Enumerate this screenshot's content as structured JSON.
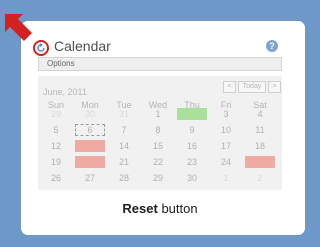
{
  "header": {
    "title": "Calendar"
  },
  "options_bar": {
    "label": "Options"
  },
  "calendar": {
    "month_label": "June, 2011",
    "nav": {
      "prev": "<",
      "today": "Today",
      "next": ">"
    },
    "weekdays": [
      "Sun",
      "Mon",
      "Tue",
      "Wed",
      "Thu",
      "Fri",
      "Sat"
    ],
    "weeks": [
      [
        "29",
        "30",
        "31",
        "1",
        "2",
        "3",
        "4"
      ],
      [
        "5",
        "6",
        "7",
        "8",
        "9",
        "10",
        "11"
      ],
      [
        "12",
        "13",
        "14",
        "15",
        "16",
        "17",
        "18"
      ],
      [
        "19",
        "20",
        "21",
        "22",
        "23",
        "24",
        "25"
      ],
      [
        "26",
        "27",
        "28",
        "29",
        "30",
        "1",
        "2"
      ]
    ],
    "highlight_colors": {
      "green": "#a8e09c",
      "red": "#f0aaa4"
    }
  },
  "caption": {
    "bold": "Reset",
    "rest": " button"
  },
  "colors": {
    "background": "#6d98c8",
    "pointer": "#d32020"
  }
}
